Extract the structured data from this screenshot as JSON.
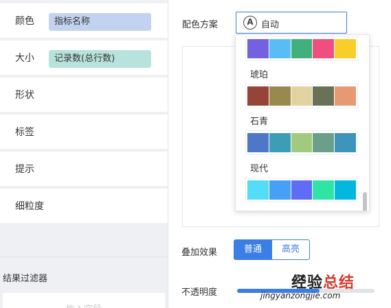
{
  "left_panel": {
    "shelves": [
      {
        "label": "颜色",
        "field": "指标名称",
        "field_color": "#c3d3ef"
      },
      {
        "label": "大小",
        "field": "记录数(总行数)",
        "field_color": "#b7e3dc"
      },
      {
        "label": "形状"
      },
      {
        "label": "标签"
      },
      {
        "label": "提示"
      },
      {
        "label": "细粒度"
      }
    ],
    "filter": {
      "title": "结果过滤器",
      "drop_placeholder": "拖入字段"
    }
  },
  "right_panel": {
    "color_scheme": {
      "label": "配色方案",
      "icon": "auto-a-icon",
      "value": "自动",
      "accent": "#3b79d9"
    },
    "overlay": {
      "label": "叠加效果",
      "options": [
        "普通",
        "高亮"
      ],
      "selected": "普通"
    },
    "opacity": {
      "label": "不透明度",
      "value": "60",
      "fraction": 0.6
    }
  },
  "dropdown": {
    "palettes": [
      {
        "name": "",
        "colors": [
          "#7461e0",
          "#58bdf2",
          "#41b07d",
          "#f04e7e",
          "#f9cd2a"
        ]
      },
      {
        "name": "琥珀",
        "colors": [
          "#954437",
          "#98894d",
          "#e3d3a0",
          "#697257",
          "#e69a74"
        ]
      },
      {
        "name": "石青",
        "colors": [
          "#4e77c8",
          "#3c9db5",
          "#a2ca7e",
          "#6c9f8a",
          "#3e94ba"
        ]
      },
      {
        "name": "现代",
        "colors": [
          "#54ddf7",
          "#46a0f7",
          "#5e6cf6",
          "#2ee5a6",
          "#03b8dc"
        ]
      }
    ]
  },
  "watermark": {
    "logo_a": "经验",
    "logo_b": "总结",
    "url": "jingyanzongjie.com"
  }
}
